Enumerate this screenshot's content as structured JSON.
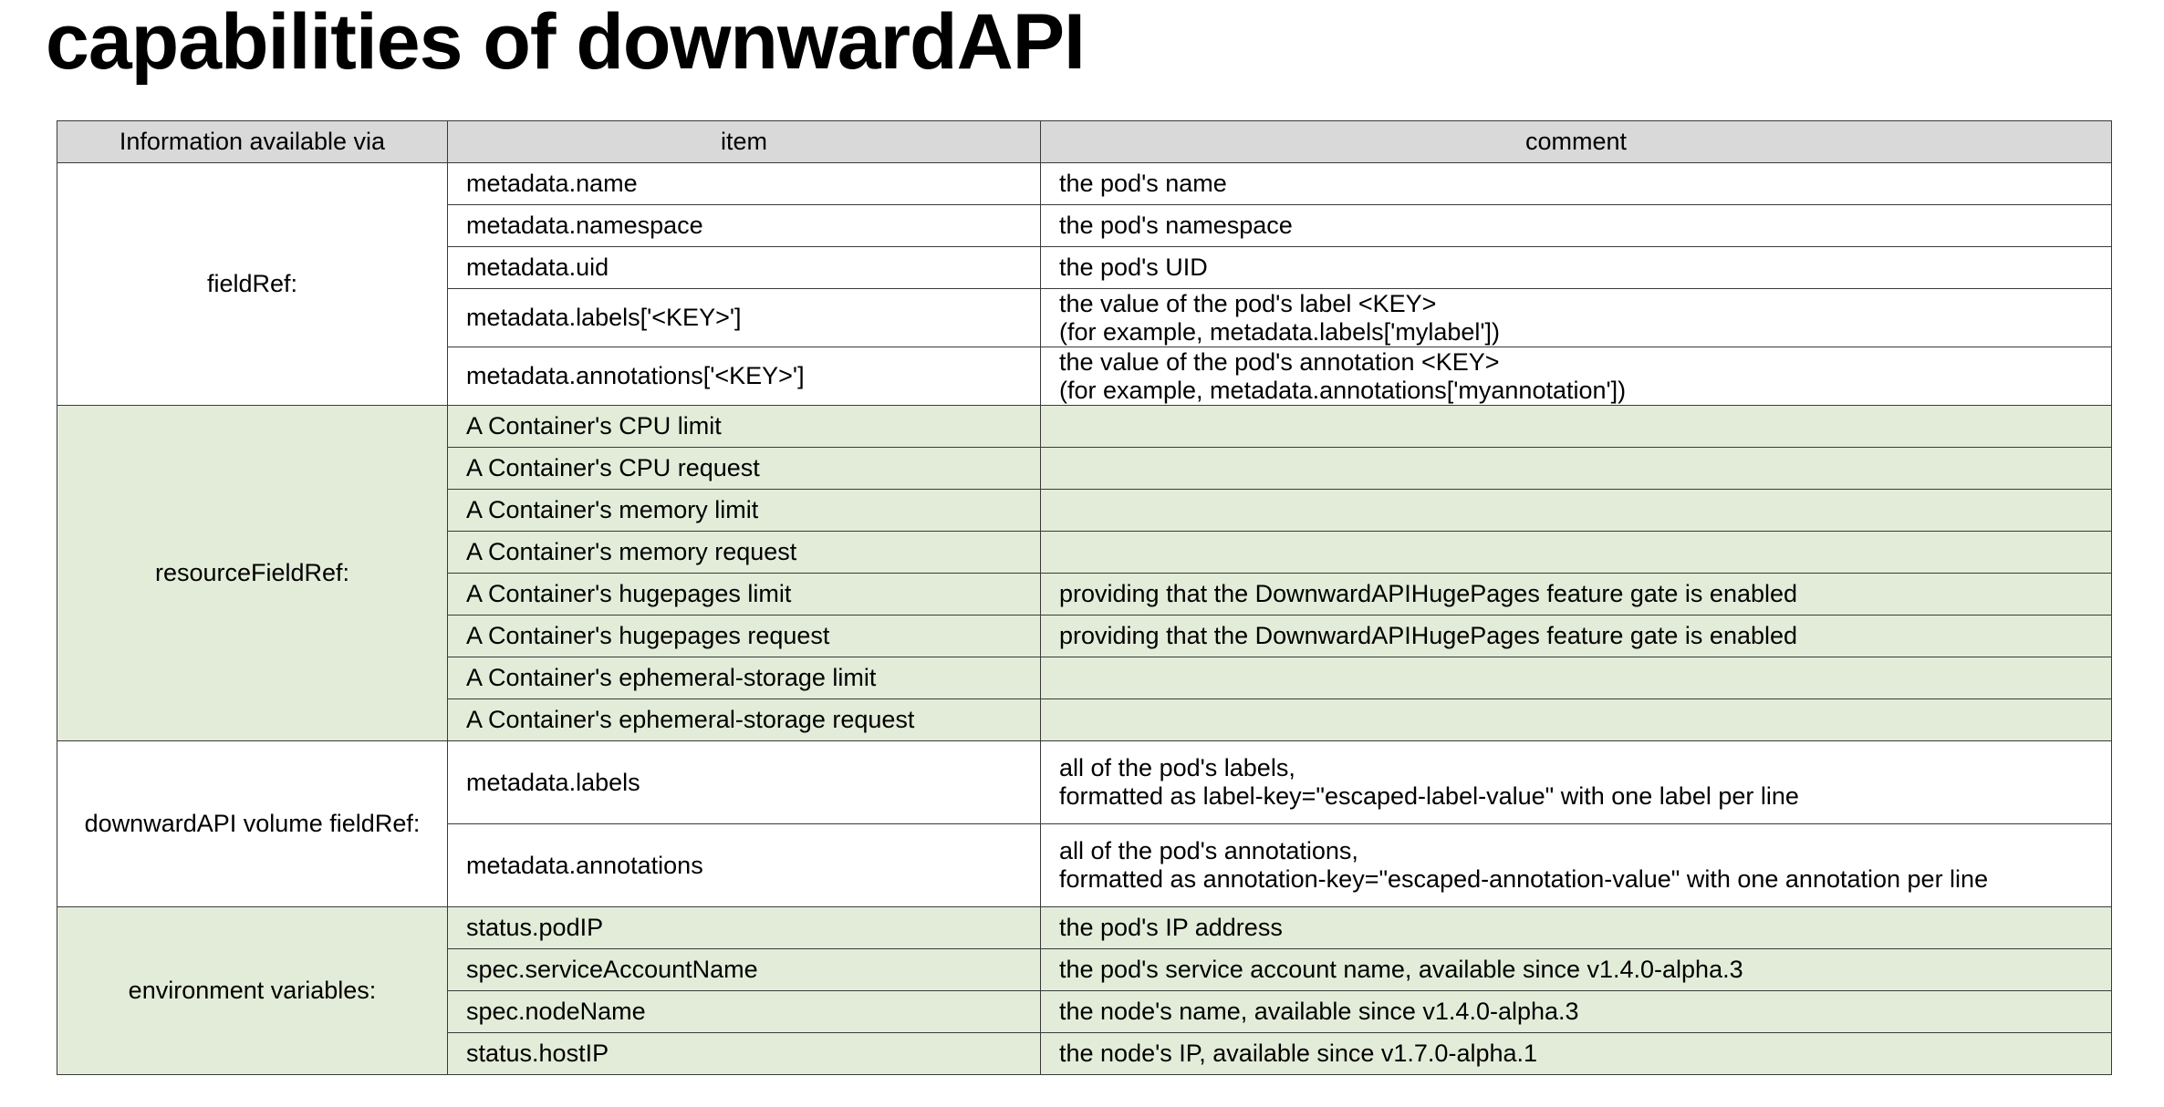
{
  "title": "capabilities of downwardAPI",
  "table": {
    "headers": [
      "Information available via",
      "item",
      "comment"
    ],
    "groups": [
      {
        "label": "fieldRef:",
        "shaded": false,
        "rows": [
          {
            "item": "metadata.name",
            "comment": [
              "the pod's name"
            ]
          },
          {
            "item": "metadata.namespace",
            "comment": [
              "the pod's namespace"
            ]
          },
          {
            "item": "metadata.uid",
            "comment": [
              "the pod's UID"
            ]
          },
          {
            "item": "metadata.labels['<KEY>']",
            "comment": [
              "the value of the pod's label <KEY>",
              "(for example, metadata.labels['mylabel'])"
            ]
          },
          {
            "item": "metadata.annotations['<KEY>']",
            "comment": [
              "the value of the pod's annotation <KEY>",
              "(for example, metadata.annotations['myannotation'])"
            ]
          }
        ]
      },
      {
        "label": "resourceFieldRef:",
        "shaded": true,
        "rows": [
          {
            "item": "A Container's CPU limit",
            "comment": []
          },
          {
            "item": "A Container's CPU request",
            "comment": []
          },
          {
            "item": "A Container's memory limit",
            "comment": []
          },
          {
            "item": "A Container's memory request",
            "comment": []
          },
          {
            "item": "A Container's hugepages limit",
            "comment": [
              "providing that the DownwardAPIHugePages feature gate is enabled"
            ]
          },
          {
            "item": "A Container's hugepages request",
            "comment": [
              "providing that the DownwardAPIHugePages feature gate is enabled"
            ]
          },
          {
            "item": "A Container's ephemeral-storage limit",
            "comment": []
          },
          {
            "item": "A Container's ephemeral-storage request",
            "comment": []
          }
        ]
      },
      {
        "label": "downwardAPI volume fieldRef:",
        "shaded": false,
        "rows": [
          {
            "item": "metadata.labels",
            "comment": [
              "all of the pod's labels,",
              "formatted as label-key=\"escaped-label-value\" with one label per line"
            ]
          },
          {
            "item": "metadata.annotations",
            "comment": [
              "all of the pod's annotations,",
              "formatted as annotation-key=\"escaped-annotation-value\" with one annotation per line"
            ]
          }
        ]
      },
      {
        "label": "environment variables:",
        "shaded": true,
        "rows": [
          {
            "item": "status.podIP",
            "comment": [
              "the pod's IP address"
            ]
          },
          {
            "item": "spec.serviceAccountName",
            "comment": [
              "the pod's service account name, available since v1.4.0-alpha.3"
            ]
          },
          {
            "item": "spec.nodeName",
            "comment": [
              "the node's name, available since v1.4.0-alpha.3"
            ]
          },
          {
            "item": "status.hostIP",
            "comment": [
              "the node's IP, available since v1.7.0-alpha.1"
            ]
          }
        ]
      }
    ]
  }
}
